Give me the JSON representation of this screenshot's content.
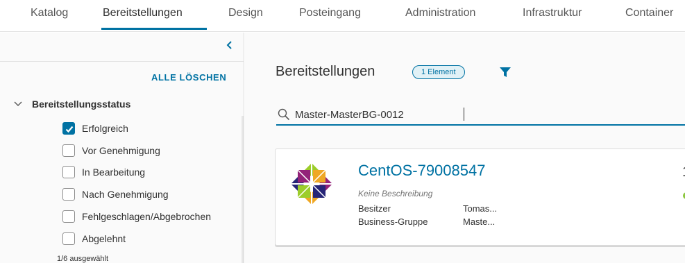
{
  "nav": {
    "tabs": [
      "Katalog",
      "Bereitstellungen",
      "Design",
      "Posteingang",
      "Administration",
      "Infrastruktur",
      "Container"
    ],
    "active_tab": "Bereitstellungen"
  },
  "sidebar": {
    "clear_all": "ALLE LÖSCHEN",
    "section_title": "Bereitstellungsstatus",
    "options": [
      {
        "label": "Erfolgreich",
        "checked": true
      },
      {
        "label": "Vor Genehmigung",
        "checked": false
      },
      {
        "label": "In Bearbeitung",
        "checked": false
      },
      {
        "label": "Nach Genehmigung",
        "checked": false
      },
      {
        "label": "Fehlgeschlagen/Abgebrochen",
        "checked": false
      },
      {
        "label": "Abgelehnt",
        "checked": false
      }
    ],
    "selected_count": "1/6 ausgewählt"
  },
  "main": {
    "title": "Bereitstellungen",
    "count_badge": "1 Element",
    "search": {
      "value": "Master-MasterBG-0012"
    },
    "card": {
      "title": "CentOS-79008547",
      "description": "Keine Beschreibung",
      "owner_key": "Besitzer",
      "owner_val": "Tomas...",
      "group_key": "Business-Gruppe",
      "group_val": "Maste...",
      "right_cut": "1",
      "status_color": "#8cc63f"
    }
  },
  "colors": {
    "accent": "#0072a3",
    "checkbox_checked": "#0072a3"
  },
  "icons": {
    "collapse": "chevron-left-icon",
    "section": "chevron-down-icon",
    "filter": "filter-icon",
    "search": "search-icon",
    "logo": "centos-logo-icon",
    "check": "check-icon"
  }
}
